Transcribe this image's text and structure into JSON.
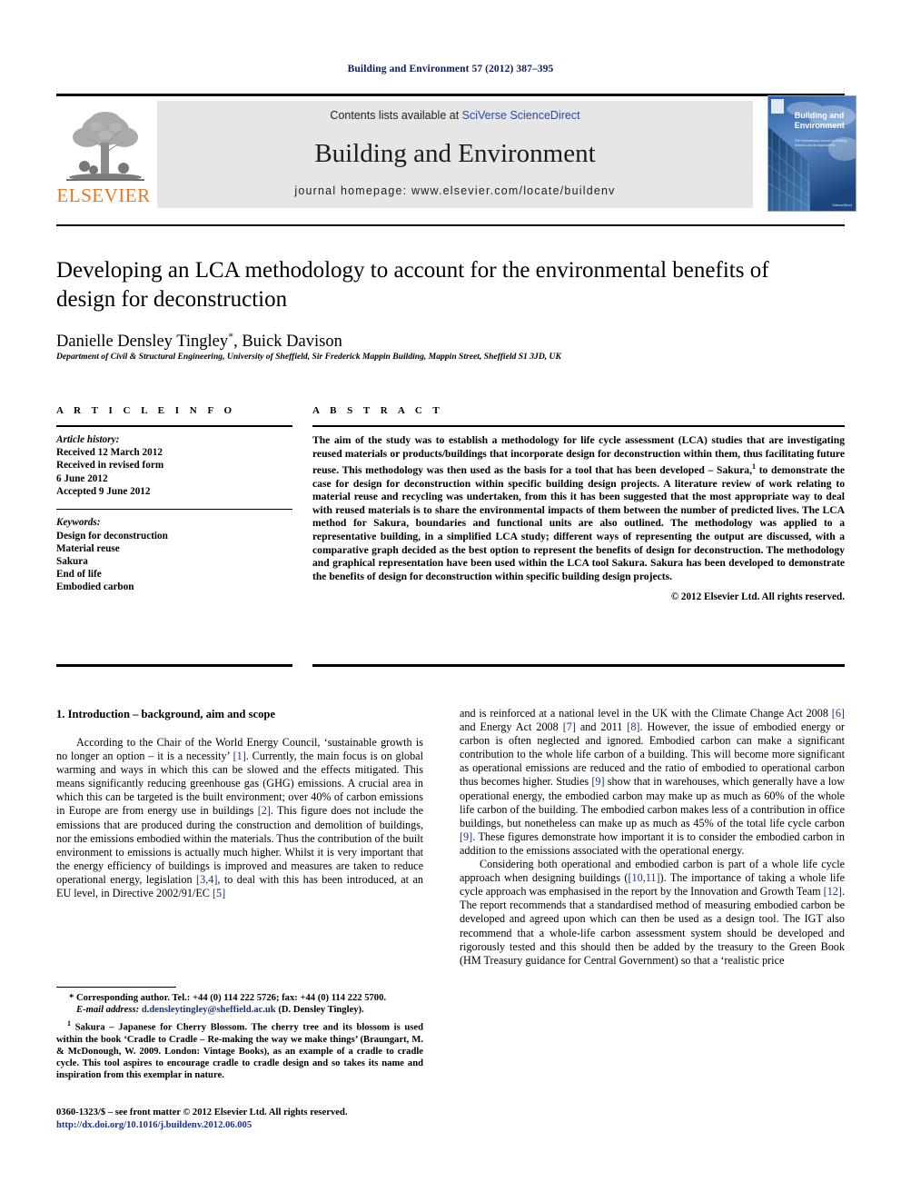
{
  "running_head": "Building and Environment 57 (2012) 387–395",
  "masthead": {
    "contents_prefix": "Contents lists available at ",
    "sciencedirect_link": "SciVerse ScienceDirect",
    "journal_title": "Building and Environment",
    "homepage_label": "journal homepage: www.elsevier.com/locate/buildenv",
    "publisher_wordmark": "ELSEVIER",
    "cover": {
      "title_line1": "Building and",
      "title_line2": "Environment",
      "subtitle": "The International Journal of Building Science and its Applications"
    }
  },
  "article": {
    "title": "Developing an LCA methodology to account for the environmental benefits of design for deconstruction",
    "authors": "Danielle Densley Tingley",
    "author_marker": "*",
    "authors_tail": ", Buick Davison",
    "affiliation": "Department of Civil & Structural Engineering, University of Sheffield, Sir Frederick Mappin Building, Mappin Street, Sheffield S1 3JD, UK"
  },
  "article_info": {
    "heading": "A R T I C L E   I N F O",
    "history_label": "Article history:",
    "history": [
      "Received 12 March 2012",
      "Received in revised form",
      "6 June 2012",
      "Accepted 9 June 2012"
    ],
    "keywords_label": "Keywords:",
    "keywords": [
      "Design for deconstruction",
      "Material reuse",
      "Sakura",
      "End of life",
      "Embodied carbon"
    ]
  },
  "abstract": {
    "heading": "A B S T R A C T",
    "text_part1": "The aim of the study was to establish a methodology for life cycle assessment (LCA) studies that are investigating reused materials or products/buildings that incorporate design for deconstruction within them, thus facilitating future reuse. This methodology was then used as the basis for a tool that has been developed – Sakura,",
    "footnote_marker": "1",
    "text_part2": " to demonstrate the case for design for deconstruction within specific building design projects. A literature review of work relating to material reuse and recycling was undertaken, from this it has been suggested that the most appropriate way to deal with reused materials is to share the environmental impacts of them between the number of predicted lives. The LCA method for Sakura, boundaries and functional units are also outlined. The methodology was applied to a representative building, in a simplified LCA study; different ways of representing the output are discussed, with a comparative graph decided as the best option to represent the benefits of design for deconstruction. The methodology and graphical representation have been used within the LCA tool Sakura. Sakura has been developed to demonstrate the benefits of design for deconstruction within specific building design projects.",
    "copyright": "© 2012 Elsevier Ltd. All rights reserved."
  },
  "body": {
    "section1_heading": "1. Introduction – background, aim and scope",
    "left_p1_a": "According to the Chair of the World Energy Council, ‘sustainable growth is no longer an option – it is a necessity’ ",
    "left_p1_r1": "[1]",
    "left_p1_b": ". Currently, the main focus is on global warming and ways in which this can be slowed and the effects mitigated. This means significantly reducing greenhouse gas (GHG) emissions. A crucial area in which this can be targeted is the built environment; over 40% of carbon emissions in Europe are from energy use in buildings ",
    "left_p1_r2": "[2]",
    "left_p1_c": ". This figure does not include the emissions that are produced during the construction and demolition of buildings, nor the emissions embodied within the materials. Thus the contribution of the built environment to emissions is actually much higher. Whilst it is very important that the energy efficiency of buildings is improved and measures are taken to reduce operational energy, legislation ",
    "left_p1_r3": "[3,4]",
    "left_p1_d": ", to deal with this has been introduced, at an EU level, in Directive 2002/91/EC ",
    "left_p1_r4": "[5]",
    "right_p1_a": "and is reinforced at a national level in the UK with the Climate Change Act 2008 ",
    "right_p1_r1": "[6]",
    "right_p1_b": " and Energy Act 2008 ",
    "right_p1_r2": "[7]",
    "right_p1_c": " and 2011 ",
    "right_p1_r3": "[8]",
    "right_p1_d": ". However, the issue of embodied energy or carbon is often neglected and ignored. Embodied carbon can make a significant contribution to the whole life carbon of a building. This will become more significant as operational emissions are reduced and the ratio of embodied to operational carbon thus becomes higher. Studies ",
    "right_p1_r4": "[9]",
    "right_p1_e": " show that in warehouses, which generally have a low operational energy, the embodied carbon may make up as much as 60% of the whole life carbon of the building. The embodied carbon makes less of a contribution in office buildings, but nonetheless can make up as much as 45% of the total life cycle carbon ",
    "right_p1_r5": "[9]",
    "right_p1_f": ". These figures demonstrate how important it is to consider the embodied carbon in addition to the emissions associated with the operational energy.",
    "right_p2_a": "Considering both operational and embodied carbon is part of a whole life cycle approach when designing buildings (",
    "right_p2_r1": "[10,11]",
    "right_p2_b": "). The importance of taking a whole life cycle approach was emphasised in the report by the Innovation and Growth Team ",
    "right_p2_r2": "[12]",
    "right_p2_c": ". The report recommends that a standardised method of measuring embodied carbon be developed and agreed upon which can then be used as a design tool. The IGT also recommend that a whole-life carbon assessment system should be developed and rigorously tested and this should then be added by the treasury to the Green Book (HM Treasury guidance for Central Government) so that a ‘realistic price"
  },
  "footnotes": {
    "corresponding_marker": "*",
    "corresponding": " Corresponding author. Tel.: +44 (0) 114 222 5726; fax: +44 (0) 114 222 5700.",
    "email_label": "E-mail address:",
    "email": "d.densleytingley@sheffield.ac.uk",
    "email_tail": " (D. Densley Tingley).",
    "note_marker": "1",
    "note": " Sakura – Japanese for Cherry Blossom. The cherry tree and its blossom is used within the book ‘Cradle to Cradle – Re-making the way we make things’ (Braungart, M. & McDonough, W. 2009. London: Vintage Books), as an example of a cradle to cradle cycle. This tool aspires to encourage cradle to cradle design and so takes its name and inspiration from this exemplar in nature."
  },
  "page_footer": {
    "issn_line": "0360-1323/$ – see front matter © 2012 Elsevier Ltd. All rights reserved.",
    "doi": "http://dx.doi.org/10.1016/j.buildenv.2012.06.005"
  },
  "colors": {
    "link": "#1d2f86",
    "running_head": "#101a5e",
    "elsevier_orange": "#e87722",
    "banner_bg": "#e6e6e6"
  }
}
